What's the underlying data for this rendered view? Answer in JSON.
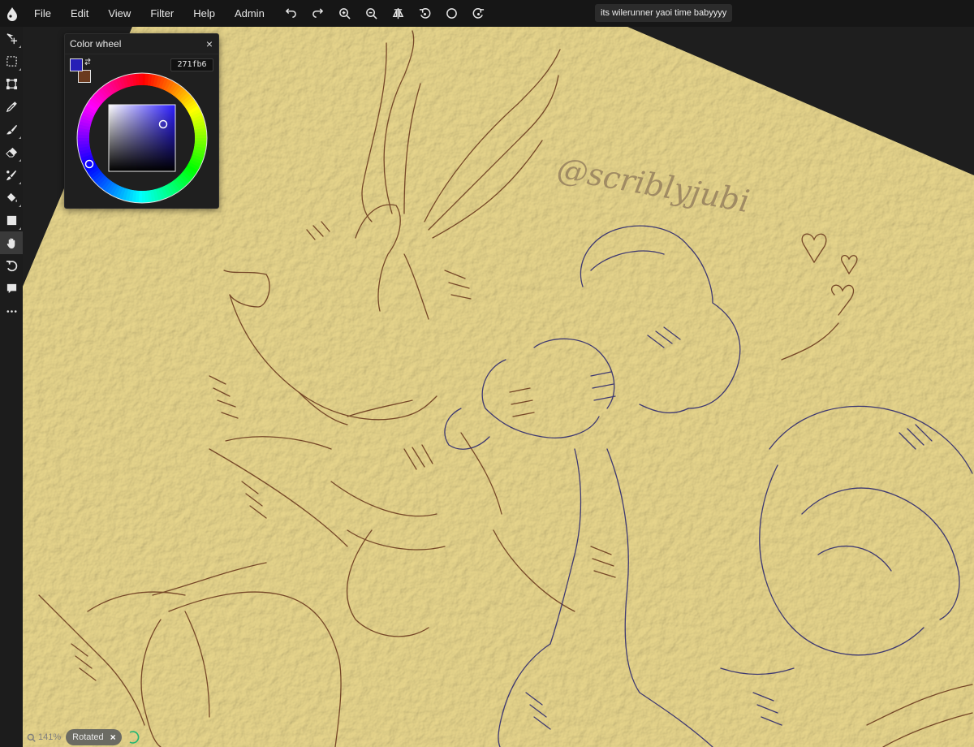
{
  "menu": {
    "logo_icon": "app-drop-logo-icon",
    "items": [
      "File",
      "Edit",
      "View",
      "Filter",
      "Help",
      "Admin"
    ],
    "toolbar_icons": [
      "undo-icon",
      "redo-icon",
      "zoom-in-icon",
      "zoom-out-icon",
      "flip-icon",
      "rotate-left-icon",
      "reset-rotation-icon",
      "rotate-right-icon"
    ],
    "room_title": "its wilerunner yaoi time babyyyy"
  },
  "tools": [
    {
      "name": "move-tool",
      "icon": "move-arrows-icon"
    },
    {
      "name": "select-tool",
      "icon": "marquee-select-icon"
    },
    {
      "name": "transform-tool",
      "icon": "transform-icon"
    },
    {
      "name": "eyedropper-tool",
      "icon": "eyedropper-icon"
    },
    {
      "name": "brush-tool",
      "icon": "brush-icon"
    },
    {
      "name": "eraser-tool",
      "icon": "eraser-icon"
    },
    {
      "name": "smudge-tool",
      "icon": "smudge-icon"
    },
    {
      "name": "fill-tool",
      "icon": "paint-bucket-icon"
    },
    {
      "name": "shape-tool",
      "icon": "square-shape-icon"
    },
    {
      "name": "hand-tool",
      "icon": "hand-icon",
      "active": true
    },
    {
      "name": "rotate-tool",
      "icon": "rotate-icon"
    },
    {
      "name": "chat-tool",
      "icon": "speech-bubble-icon"
    },
    {
      "name": "more-tools",
      "icon": "ellipsis-icon"
    }
  ],
  "color_wheel": {
    "title": "Color wheel",
    "close_label": "×",
    "hex_value": "271fb6",
    "primary_color": "#271fb6",
    "secondary_color": "#6b3a1e"
  },
  "canvas": {
    "paper_color": "#ecdfa6",
    "background_color": "#1e1e1e",
    "stroke_brown": "#6b3a1e",
    "stroke_blue": "#23206e",
    "watermark_text": "@scriblyjubi"
  },
  "status": {
    "zoom_level": "141%",
    "rotated_label": "Rotated",
    "rotated_close": "×"
  }
}
